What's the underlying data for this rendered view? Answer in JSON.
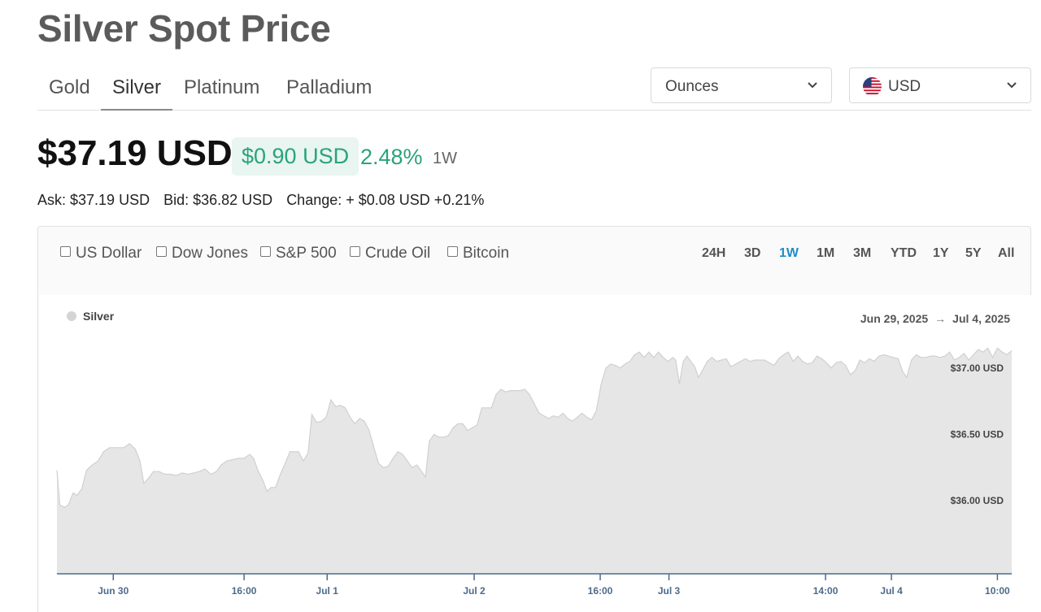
{
  "page": {
    "title": "Silver Spot Price"
  },
  "tabs": [
    {
      "label": "Gold"
    },
    {
      "label": "Silver"
    },
    {
      "label": "Platinum"
    },
    {
      "label": "Palladium"
    }
  ],
  "unit_select": {
    "value": "Ounces"
  },
  "currency_select": {
    "value": "USD",
    "flag_icon": "us-flag-icon"
  },
  "price": {
    "current": "$37.19 USD",
    "change_amount": "$0.90 USD",
    "change_percent": "2.48%",
    "period": "1W",
    "ask": "Ask: $37.19 USD",
    "bid": "Bid: $36.82 USD",
    "change_line": "Change: + $0.08 USD +0.21%"
  },
  "colors": {
    "positive": "#2aa37a",
    "active_range": "#1f8dc9",
    "area_fill": "#e6e6e6",
    "area_stroke": "#d0d0d0"
  },
  "compare": [
    {
      "label": "US Dollar"
    },
    {
      "label": "Dow Jones"
    },
    {
      "label": "S&P 500"
    },
    {
      "label": "Crude Oil"
    },
    {
      "label": "Bitcoin"
    }
  ],
  "ranges": [
    {
      "label": "24H"
    },
    {
      "label": "3D"
    },
    {
      "label": "1W"
    },
    {
      "label": "1M"
    },
    {
      "label": "3M"
    },
    {
      "label": "YTD"
    },
    {
      "label": "1Y"
    },
    {
      "label": "5Y"
    },
    {
      "label": "All"
    }
  ],
  "chart_data": {
    "type": "area",
    "legend": [
      "Silver"
    ],
    "legend_placement": "top-left",
    "date_range": {
      "from": "Jun 29, 2025",
      "to": "Jul 4, 2025"
    },
    "grid": false,
    "ylim": [
      35.45,
      37.55
    ],
    "y_ticks": [
      {
        "value": 37.0,
        "label": "$37.00 USD"
      },
      {
        "value": 36.5,
        "label": "$36.50 USD"
      },
      {
        "value": 36.0,
        "label": "$36.00 USD"
      }
    ],
    "x_range": [
      0,
      1000
    ],
    "x_ticks": [
      {
        "x": 59,
        "label": "Jun 30"
      },
      {
        "x": 196,
        "label": "16:00"
      },
      {
        "x": 283,
        "label": "Jul 1"
      },
      {
        "x": 437,
        "label": "Jul 2"
      },
      {
        "x": 569,
        "label": "16:00"
      },
      {
        "x": 641,
        "label": "Jul 3"
      },
      {
        "x": 805,
        "label": "14:00"
      },
      {
        "x": 874,
        "label": "Jul 4"
      },
      {
        "x": 985,
        "label": "10:00"
      }
    ],
    "series": [
      {
        "name": "Silver",
        "points": [
          [
            0,
            36.23
          ],
          [
            3,
            35.97
          ],
          [
            8,
            35.95
          ],
          [
            12,
            35.97
          ],
          [
            17,
            36.06
          ],
          [
            21,
            36.04
          ],
          [
            26,
            36.09
          ],
          [
            31,
            36.23
          ],
          [
            37,
            36.27
          ],
          [
            43,
            36.3
          ],
          [
            49,
            36.37
          ],
          [
            55,
            36.4
          ],
          [
            63,
            36.4
          ],
          [
            70,
            36.4
          ],
          [
            76,
            36.43
          ],
          [
            82,
            36.39
          ],
          [
            87,
            36.3
          ],
          [
            91,
            36.13
          ],
          [
            96,
            36.17
          ],
          [
            101,
            36.22
          ],
          [
            107,
            36.22
          ],
          [
            113,
            36.2
          ],
          [
            119,
            36.2
          ],
          [
            125,
            36.19
          ],
          [
            131,
            36.21
          ],
          [
            137,
            36.2
          ],
          [
            143,
            36.21
          ],
          [
            149,
            36.22
          ],
          [
            155,
            36.24
          ],
          [
            161,
            36.2
          ],
          [
            167,
            36.22
          ],
          [
            172,
            36.27
          ],
          [
            178,
            36.3
          ],
          [
            184,
            36.31
          ],
          [
            190,
            36.32
          ],
          [
            196,
            36.32
          ],
          [
            202,
            36.35
          ],
          [
            206,
            36.32
          ],
          [
            211,
            36.22
          ],
          [
            216,
            36.15
          ],
          [
            220,
            36.07
          ],
          [
            224,
            36.1
          ],
          [
            229,
            36.1
          ],
          [
            234,
            36.2
          ],
          [
            239,
            36.28
          ],
          [
            244,
            36.37
          ],
          [
            249,
            36.37
          ],
          [
            253,
            36.37
          ],
          [
            258,
            36.3
          ],
          [
            263,
            36.36
          ],
          [
            267,
            36.65
          ],
          [
            272,
            36.59
          ],
          [
            277,
            36.6
          ],
          [
            282,
            36.63
          ],
          [
            287,
            36.76
          ],
          [
            292,
            36.71
          ],
          [
            297,
            36.72
          ],
          [
            302,
            36.7
          ],
          [
            307,
            36.63
          ],
          [
            312,
            36.58
          ],
          [
            317,
            36.62
          ],
          [
            322,
            36.6
          ],
          [
            327,
            36.53
          ],
          [
            332,
            36.4
          ],
          [
            337,
            36.28
          ],
          [
            342,
            36.25
          ],
          [
            347,
            36.26
          ],
          [
            352,
            36.32
          ],
          [
            357,
            36.37
          ],
          [
            362,
            36.35
          ],
          [
            367,
            36.3
          ],
          [
            372,
            36.25
          ],
          [
            377,
            36.27
          ],
          [
            382,
            36.22
          ],
          [
            386,
            36.18
          ],
          [
            390,
            36.45
          ],
          [
            395,
            36.5
          ],
          [
            400,
            36.48
          ],
          [
            405,
            36.48
          ],
          [
            410,
            36.49
          ],
          [
            415,
            36.55
          ],
          [
            420,
            36.58
          ],
          [
            425,
            36.58
          ],
          [
            430,
            36.53
          ],
          [
            435,
            36.55
          ],
          [
            440,
            36.57
          ],
          [
            445,
            36.7
          ],
          [
            450,
            36.7
          ],
          [
            455,
            36.7
          ],
          [
            460,
            36.8
          ],
          [
            465,
            36.84
          ],
          [
            470,
            36.82
          ],
          [
            475,
            36.83
          ],
          [
            480,
            36.83
          ],
          [
            485,
            36.83
          ],
          [
            490,
            36.84
          ],
          [
            495,
            36.8
          ],
          [
            500,
            36.73
          ],
          [
            505,
            36.66
          ],
          [
            510,
            36.64
          ],
          [
            515,
            36.62
          ],
          [
            520,
            36.64
          ],
          [
            525,
            36.63
          ],
          [
            530,
            36.66
          ],
          [
            535,
            36.62
          ],
          [
            540,
            36.6
          ],
          [
            545,
            36.63
          ],
          [
            550,
            36.66
          ],
          [
            555,
            36.63
          ],
          [
            560,
            36.61
          ],
          [
            565,
            36.68
          ],
          [
            570,
            36.88
          ],
          [
            575,
            37.0
          ],
          [
            580,
            37.03
          ],
          [
            585,
            37.02
          ],
          [
            590,
            37.0
          ],
          [
            595,
            37.03
          ],
          [
            600,
            37.05
          ],
          [
            605,
            37.1
          ],
          [
            610,
            37.12
          ],
          [
            615,
            37.08
          ],
          [
            620,
            37.12
          ],
          [
            625,
            37.08
          ],
          [
            630,
            37.12
          ],
          [
            635,
            37.08
          ],
          [
            640,
            37.05
          ],
          [
            645,
            37.08
          ],
          [
            648,
            37.06
          ],
          [
            652,
            36.88
          ],
          [
            656,
            37.05
          ],
          [
            660,
            37.09
          ],
          [
            664,
            37.05
          ],
          [
            668,
            37.01
          ],
          [
            672,
            36.93
          ],
          [
            676,
            36.98
          ],
          [
            681,
            37.05
          ],
          [
            686,
            37.08
          ],
          [
            691,
            37.05
          ],
          [
            696,
            37.06
          ],
          [
            701,
            37.07
          ],
          [
            706,
            37.01
          ],
          [
            711,
            37.03
          ],
          [
            716,
            37.05
          ],
          [
            721,
            37.07
          ],
          [
            726,
            37.05
          ],
          [
            731,
            37.06
          ],
          [
            736,
            37.06
          ],
          [
            741,
            37.06
          ],
          [
            746,
            37.04
          ],
          [
            751,
            37.02
          ],
          [
            756,
            37.07
          ],
          [
            761,
            37.1
          ],
          [
            766,
            37.12
          ],
          [
            771,
            37.05
          ],
          [
            776,
            37.09
          ],
          [
            781,
            37.05
          ],
          [
            786,
            37.03
          ],
          [
            791,
            37.04
          ],
          [
            796,
            37.09
          ],
          [
            801,
            37.07
          ],
          [
            806,
            37.04
          ],
          [
            811,
            37.0
          ],
          [
            816,
            37.04
          ],
          [
            821,
            37.05
          ],
          [
            826,
            37.02
          ],
          [
            831,
            36.95
          ],
          [
            836,
            36.98
          ],
          [
            841,
            37.06
          ],
          [
            846,
            37.04
          ],
          [
            851,
            37.07
          ],
          [
            856,
            37.05
          ],
          [
            861,
            37.09
          ],
          [
            866,
            37.1
          ],
          [
            871,
            37.09
          ],
          [
            876,
            37.08
          ],
          [
            881,
            37.07
          ],
          [
            886,
            36.97
          ],
          [
            890,
            36.93
          ],
          [
            895,
            37.06
          ],
          [
            900,
            37.1
          ],
          [
            905,
            37.08
          ],
          [
            910,
            37.08
          ],
          [
            915,
            37.09
          ],
          [
            920,
            37.09
          ],
          [
            925,
            37.08
          ],
          [
            930,
            37.09
          ],
          [
            935,
            37.12
          ],
          [
            940,
            37.06
          ],
          [
            945,
            37.08
          ],
          [
            950,
            37.11
          ],
          [
            955,
            37.06
          ],
          [
            960,
            37.1
          ],
          [
            965,
            37.14
          ],
          [
            970,
            37.12
          ],
          [
            975,
            37.15
          ],
          [
            980,
            37.08
          ],
          [
            985,
            37.15
          ],
          [
            990,
            37.12
          ],
          [
            995,
            37.1
          ],
          [
            1000,
            37.13
          ]
        ]
      }
    ]
  }
}
